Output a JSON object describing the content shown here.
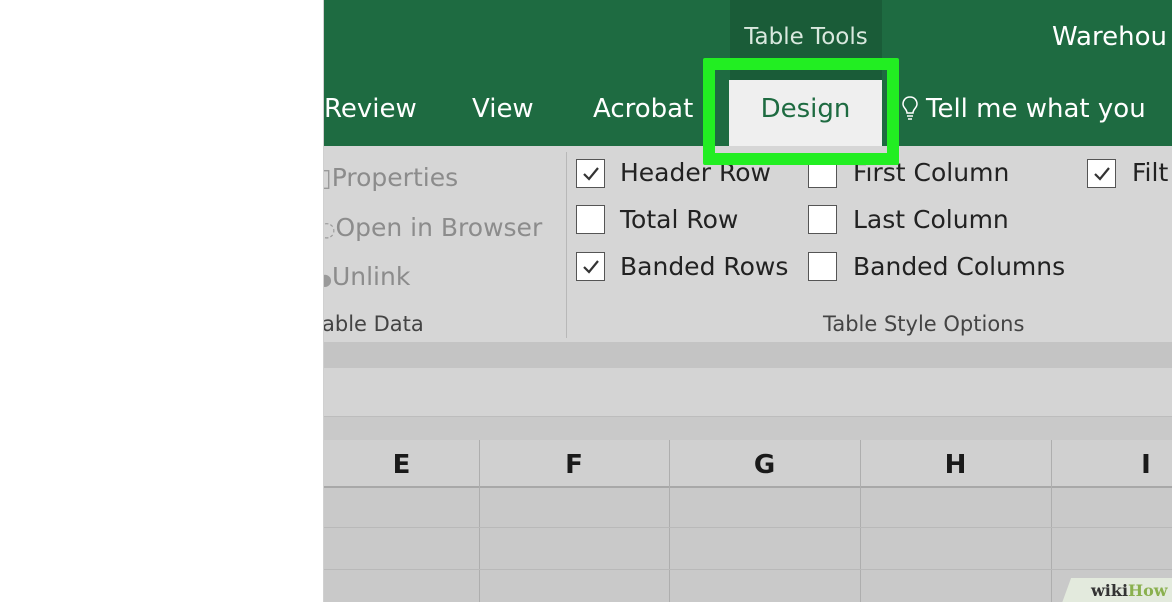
{
  "titlebar": {
    "contextual_label": "Table Tools",
    "window_title": "Warehou"
  },
  "tabs": {
    "review": "Review",
    "view": "View",
    "acrobat": "Acrobat",
    "design": "Design",
    "tell_me": "Tell me what you"
  },
  "ribbon": {
    "external_data": {
      "properties": "Properties",
      "open_in_browser": "Open in Browser",
      "unlink": "Unlink",
      "group_label": "able Data"
    },
    "style_options": {
      "group_label": "Table Style Options",
      "header_row": {
        "label": "Header Row",
        "checked": true
      },
      "total_row": {
        "label": "Total Row",
        "checked": false
      },
      "banded_rows": {
        "label": "Banded Rows",
        "checked": true
      },
      "first_column": {
        "label": "First Column",
        "checked": false
      },
      "last_column": {
        "label": "Last Column",
        "checked": false
      },
      "banded_columns": {
        "label": "Banded Columns",
        "checked": false
      },
      "filter": {
        "label": "Filt",
        "checked": true
      }
    }
  },
  "grid": {
    "columns": [
      "E",
      "F",
      "G",
      "H",
      "I"
    ]
  },
  "watermark": {
    "wiki": "wiki",
    "how": "How"
  },
  "colors": {
    "excel_green": "#1e6b41",
    "highlight": "#22ee22",
    "ribbon_bg": "#d6d6d6"
  }
}
